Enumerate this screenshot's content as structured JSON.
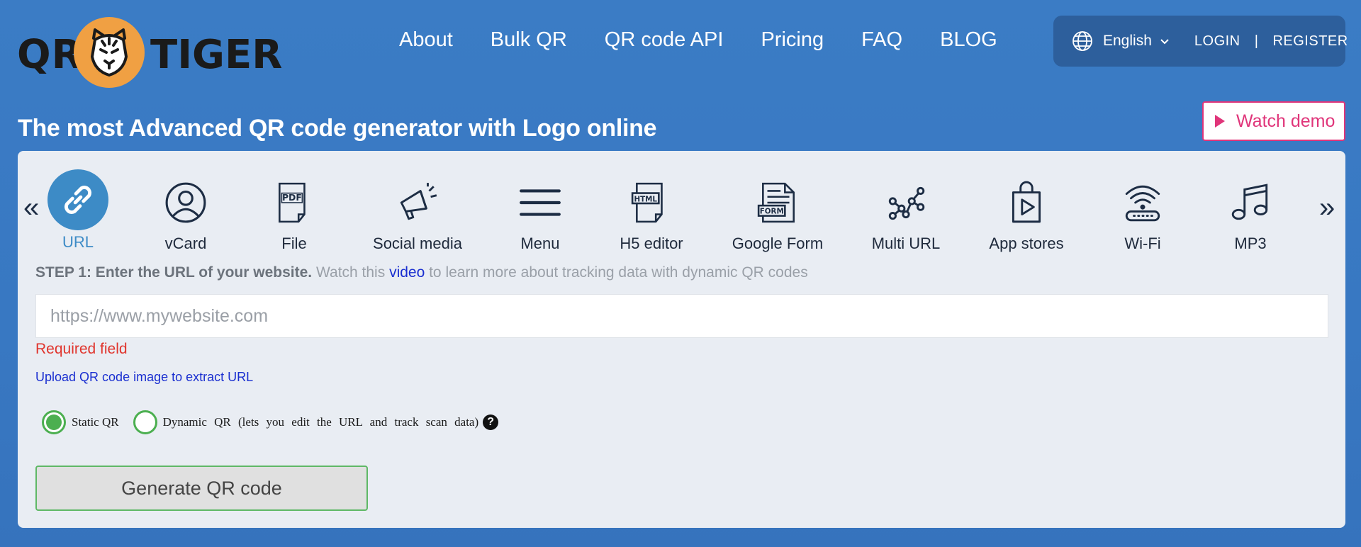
{
  "brand": {
    "logo_left": "QR",
    "logo_right": "TIGER",
    "logo_color": "#f0a043"
  },
  "nav": [
    "About",
    "Bulk QR",
    "QR code API",
    "Pricing",
    "FAQ",
    "BLOG"
  ],
  "account": {
    "language": "English",
    "login": "LOGIN",
    "separator": "|",
    "register": "REGISTER"
  },
  "headline": "The most Advanced QR code generator with Logo online",
  "watch_demo": "Watch demo",
  "qr_types": [
    {
      "label": "URL",
      "icon": "link-icon",
      "active": true
    },
    {
      "label": "vCard",
      "icon": "person-icon"
    },
    {
      "label": "File",
      "icon": "pdf-file-icon"
    },
    {
      "label": "Social media",
      "icon": "megaphone-icon"
    },
    {
      "label": "Menu",
      "icon": "menu-icon"
    },
    {
      "label": "H5 editor",
      "icon": "html-file-icon"
    },
    {
      "label": "Google Form",
      "icon": "form-icon"
    },
    {
      "label": "Multi URL",
      "icon": "network-icon"
    },
    {
      "label": "App stores",
      "icon": "app-store-bag-icon"
    },
    {
      "label": "Wi-Fi",
      "icon": "wifi-router-icon"
    },
    {
      "label": "MP3",
      "icon": "music-note-icon"
    }
  ],
  "step": {
    "bold": "STEP 1: Enter the URL of your website.",
    "pre": " Watch this ",
    "link": "video",
    "post": " to learn more about tracking data with dynamic QR codes"
  },
  "url_input": {
    "placeholder": "https://www.mywebsite.com",
    "value": ""
  },
  "required_text": "Required field",
  "upload_link": "Upload QR code image to extract URL",
  "qr_mode": {
    "static_label": "Static QR",
    "dynamic_label": "Dynamic QR (lets you edit the URL and track scan data)",
    "selected": "static",
    "help": "?"
  },
  "generate_button": "Generate QR code",
  "colors": {
    "accent_blue": "#3d8bc6",
    "demo_pink": "#e0357a",
    "success_green": "#4caf50",
    "error_red": "#e0342c"
  }
}
